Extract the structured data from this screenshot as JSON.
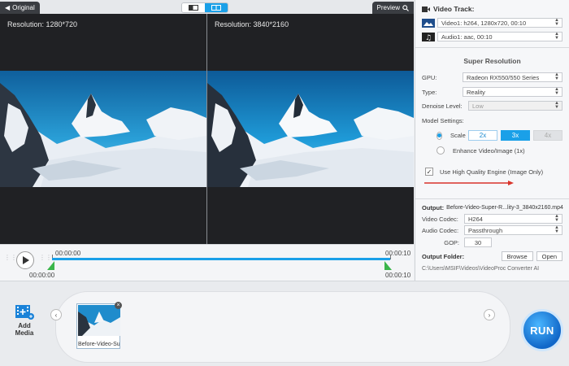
{
  "preview": {
    "tab_original": "Original",
    "tab_preview": "Preview",
    "left_resolution": "Resolution: 1280*720",
    "right_resolution": "Resolution: 3840*2160"
  },
  "timeline": {
    "start_top": "00:00:00",
    "start_bottom": "00:00:00",
    "end_top": "00:00:10",
    "end_bottom": "00:00:10",
    "progress_fraction": 1.0
  },
  "panel": {
    "video_track_title": "Video Track:",
    "video_stream": "Video1: h264, 1280x720, 00:10",
    "audio_stream": "Audio1: aac, 00:10",
    "super_resolution_title": "Super Resolution",
    "gpu_label": "GPU:",
    "gpu_value": "Radeon RX550/550 Series",
    "type_label": "Type:",
    "type_value": "Reality",
    "denoise_label": "Denoise Level:",
    "denoise_value": "Low",
    "model_settings_label": "Model Settings:",
    "scale_label": "Scale",
    "scale_options": [
      "2x",
      "3x",
      "4x"
    ],
    "scale_selected": "3x",
    "enhance_label": "Enhance Video/Image (1x)",
    "hq_engine_label": "Use High Quality Engine (Image Only)",
    "hq_engine_checked": true,
    "output_label": "Output:",
    "output_file": "Before-Video-Super-R...lity-3_3840x2160.mp4",
    "video_codec_label": "Video Codec:",
    "video_codec_value": "H264",
    "audio_codec_label": "Audio Codec:",
    "audio_codec_value": "Passthrough",
    "gop_label": "GOP:",
    "gop_value": "30",
    "output_folder_label": "Output Folder:",
    "browse_label": "Browse",
    "open_label": "Open",
    "folder_path": "C:\\Users\\MSIF\\Videos\\VideoProc Converter AI"
  },
  "bottom": {
    "add_media_label": "Add Media",
    "thumb_label": "Before-Video-Sup",
    "run_label": "RUN"
  },
  "colors": {
    "accent": "#1aa0e8",
    "timeline_handle": "#3ab54a",
    "arrow": "#d9342b"
  }
}
